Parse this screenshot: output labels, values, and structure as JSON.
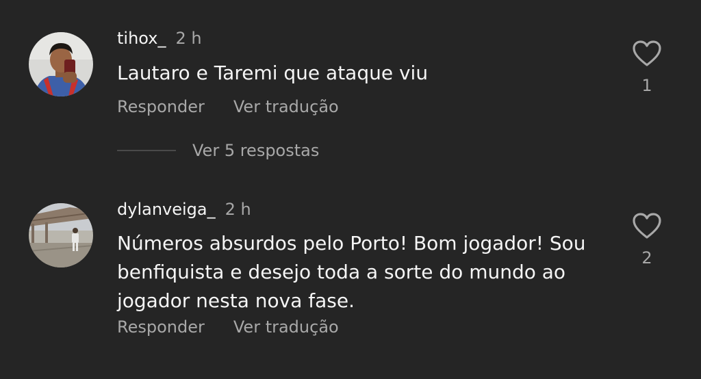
{
  "comments": [
    {
      "username": "tihox_",
      "time": "2 h",
      "text": "Lautaro e Taremi que ataque viu",
      "reply_label": "Responder",
      "translate_label": "Ver tradução",
      "likes": "1",
      "view_replies_label": "Ver 5 respostas"
    },
    {
      "username": "dylanveiga_",
      "time": "2 h",
      "text": "Números absurdos pelo Porto! Bom jogador! Sou benfiquista e desejo toda a sorte do mundo ao jogador nesta nova fase.",
      "reply_label": "Responder",
      "translate_label": "Ver tradução",
      "likes": "2"
    }
  ],
  "colors": {
    "background": "#252525",
    "primary_text": "#f5f5f5",
    "secondary_text": "#a8a8a8",
    "divider": "#4a4a4a"
  },
  "icons": {
    "like": "heart-outline-icon"
  }
}
